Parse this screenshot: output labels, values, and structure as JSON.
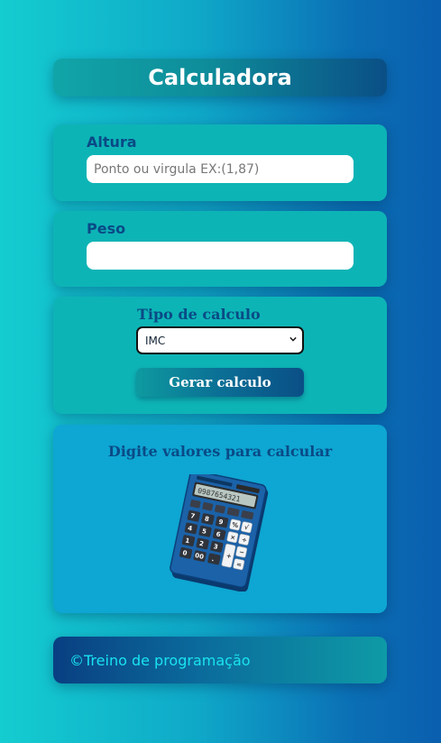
{
  "header": {
    "title": "Calculadora"
  },
  "altura": {
    "label": "Altura",
    "placeholder": "Ponto ou virgula EX:(1,87)",
    "value": ""
  },
  "peso": {
    "label": "Peso",
    "placeholder": "",
    "value": ""
  },
  "tipo": {
    "label": "Tipo de calculo",
    "selected": "IMC",
    "button_label": "Gerar calculo"
  },
  "result": {
    "message": "Digite valores para calcular",
    "image_icon": "calculator-icon"
  },
  "footer": {
    "text": "©Treino de programação"
  },
  "colors": {
    "accent": "#0a4a86",
    "field_bg": "#0db4b6",
    "result_bg": "#0ea6d2",
    "footer_text": "#19e3ef"
  }
}
